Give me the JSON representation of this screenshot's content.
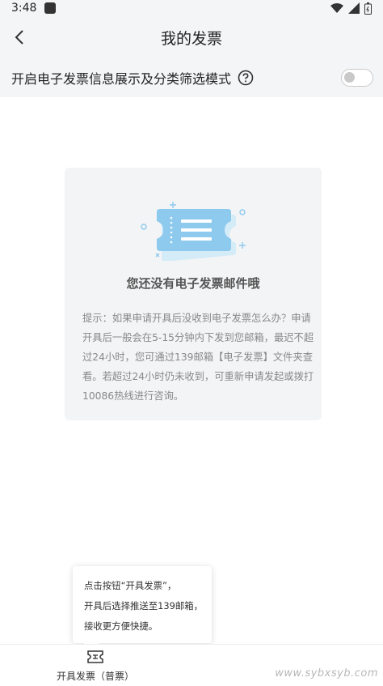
{
  "status_bar": {
    "time": "3:48"
  },
  "header": {
    "title": "我的发票"
  },
  "toggle_row": {
    "label": "开启电子发票信息展示及分类筛选模式",
    "enabled": false
  },
  "empty_state": {
    "title": "您还没有电子发票邮件哦",
    "hint": "提示：如果申请开具后没收到电子发票怎么办？申请开具后一般会在5-15分钟内下发到您邮箱，最迟不超过24小时，您可通过139邮箱【电子发票】文件夹查看。若超过24小时仍未收到，可重新申请发起或拨打10086热线进行咨询。"
  },
  "tooltip": {
    "line1": "点击按钮“开具发票”，",
    "line2": "开具后选择推送至139邮箱，",
    "line3": "接收更方便快捷。"
  },
  "bottom_bar": {
    "issue_invoice_label": "开具发票（普票）"
  },
  "watermark": "www.sybxsyb.com",
  "colors": {
    "accent_blue": "#8ec9ee",
    "background_gray": "#f4f5f7"
  }
}
